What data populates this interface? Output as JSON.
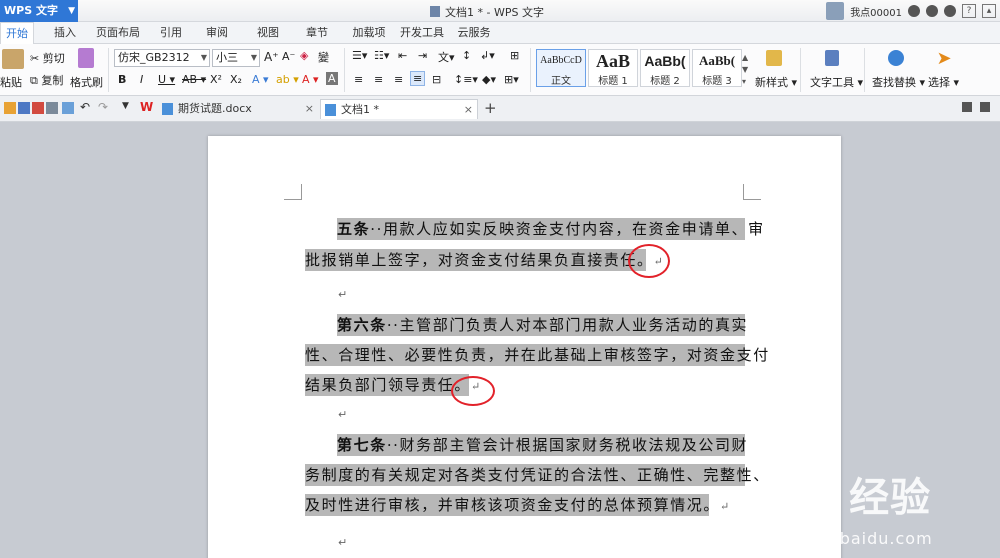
{
  "titlebar": {
    "app_button": "WPS 文字",
    "window_title": "文档1 * - WPS 文字",
    "user_name": "我点00001"
  },
  "menu_tabs": [
    "开始",
    "插入",
    "页面布局",
    "引用",
    "审阅",
    "视图",
    "章节",
    "加载项",
    "开发工具",
    "云服务"
  ],
  "ribbon": {
    "paste": "粘贴",
    "cut": "剪切",
    "copy": "复制",
    "format_painter": "格式刷",
    "font_name": "仿宋_GB2312",
    "font_size": "小三",
    "styles": [
      {
        "sample": "AaBbCcD",
        "name": "正文"
      },
      {
        "sample": "AaB",
        "name": "标题 1"
      },
      {
        "sample": "AaBb(",
        "name": "标题 2"
      },
      {
        "sample": "AaBb(",
        "name": "标题 3"
      }
    ],
    "new_style": "新样式",
    "text_tools": "文字工具",
    "find_replace": "查找替换",
    "select": "选择"
  },
  "doc_tabs": [
    {
      "label": "期货试题.docx"
    },
    {
      "label": "文档1 *"
    }
  ],
  "document": {
    "paragraphs": [
      {
        "heading": "五条",
        "line1": "··用款人应如实反映资金支付内容，在资金申请单、审",
        "line2": "批报销单上签字，对资金支付结果负直接责任。"
      },
      {
        "heading": "第六条",
        "line1": "··主管部门负责人对本部门用款人业务活动的真实",
        "line2": "性、合理性、必要性负责，并在此基础上审核签字，对资金支付",
        "line3": "结果负部门领导责任。"
      },
      {
        "heading": "第七条",
        "line1": "··财务部主管会计根据国家财务税收法规及公司财",
        "line2": "务制度的有关规定对各类支付凭证的合法性、正确性、完整性、",
        "line3": "及时性进行审核，并审核该项资金支付的总体预算情况。"
      }
    ],
    "paragraph_mark": "↵"
  },
  "watermark": {
    "brand": "Bai  经验",
    "url": "jingyan.baidu.com"
  },
  "colors": {
    "accent": "#2f77d6",
    "selection": "#b7b7b7",
    "annotation": "#e2222a"
  }
}
